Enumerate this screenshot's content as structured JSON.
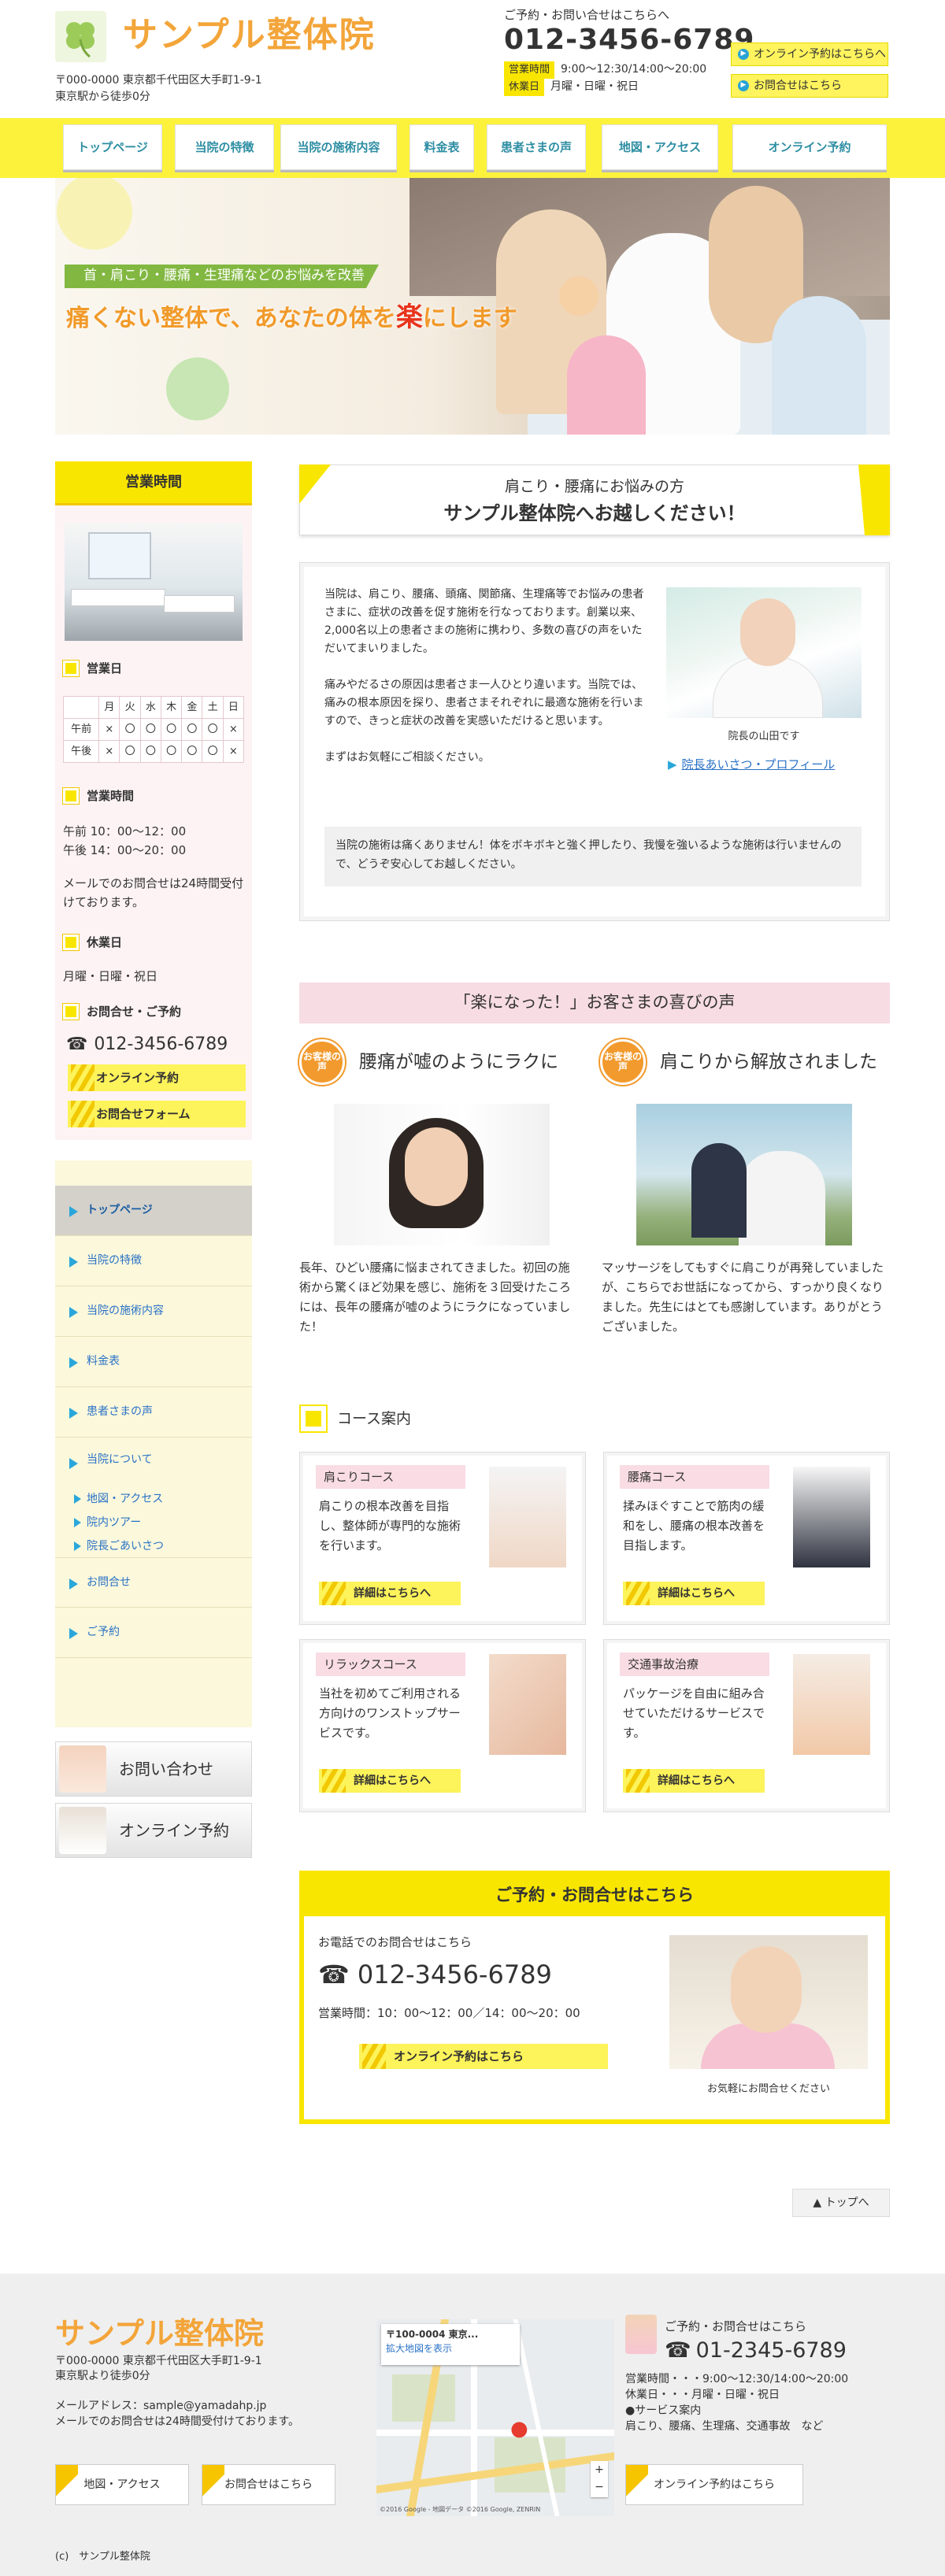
{
  "header": {
    "site_name": "サンプル整体院",
    "address_line1": "〒000-0000 東京都千代田区大手町1-9-1",
    "address_line2": "東京駅から徒歩0分",
    "tel_caption": "ご予約・お問い合せはこちらへ",
    "tel": "012-3456-6789",
    "hours_tag": "営業時間",
    "hours": "9:00〜12:30/14:00〜20:00",
    "closed_tag": "休業日",
    "closed": "月曜・日曜・祝日",
    "btn_online": "オンライン予約はこちらへ",
    "btn_contact": "お問合せはこちら"
  },
  "nav": [
    "トップページ",
    "当院の特徴",
    "当院の施術内容",
    "料金表",
    "患者さまの声",
    "地図・アクセス",
    "オンライン予約"
  ],
  "hero": {
    "tag": "首・肩こり・腰痛・生理痛などのお悩みを改善",
    "copy_pre": "痛くない整体で、あなたの体を",
    "copy_em": "楽",
    "copy_post": "にします"
  },
  "sidebar": {
    "hours_title": "営業時間",
    "sec_business_days": "営業日",
    "schedule": {
      "header": [
        "",
        "月",
        "火",
        "水",
        "木",
        "金",
        "土",
        "日"
      ],
      "rows": [
        [
          "午前",
          "×",
          "〇",
          "〇",
          "〇",
          "〇",
          "〇",
          "×"
        ],
        [
          "午後",
          "×",
          "〇",
          "〇",
          "〇",
          "〇",
          "〇",
          "×"
        ]
      ]
    },
    "sec_hours": "営業時間",
    "hours_am": "午前 10：00〜12：00",
    "hours_pm": "午後 14：00〜20：00",
    "mail_note": "メールでのお問合せは24時間受付けております。",
    "sec_closed": "休業日",
    "closed": "月曜・日曜・祝日",
    "sec_contact": "お問合せ・ご予約",
    "tel": "012-3456-6789",
    "btn_online": "オンライン予約",
    "btn_form": "お問合せフォーム",
    "menu": [
      "トップページ",
      "当院の特徴",
      "当院の施術内容",
      "料金表",
      "患者さまの声",
      "当院について"
    ],
    "submenu": [
      "地図・アクセス",
      "院内ツアー",
      "院長ごあいさつ"
    ],
    "menu2": [
      "お問合せ",
      "ご予約"
    ],
    "banner_contact": "お問い合わせ",
    "banner_online": "オンライン予約"
  },
  "main": {
    "head_line1": "肩こり・腰痛にお悩みの方",
    "head_line2": "サンプル整体院へお越しください！",
    "intro_p1": "当院は、肩こり、腰痛、頭痛、関節痛、生理痛等でお悩みの患者さまに、症状の改善を促す施術を行なっております。創業以来、2,000名以上の患者さまの施術に携わり、多数の喜びの声をいただいてまいりました。",
    "intro_p2": "痛みやだるさの原因は患者さま一人ひとり違います。当院では、痛みの根本原因を探り、患者さまそれぞれに最適な施術を行いますので、きっと症状の改善を実感いただけると思います。",
    "intro_p3": "まずはお気軽にご相談ください。",
    "doc_caption": "院長の山田です",
    "doc_link": "院長あいさつ・プロフィール",
    "note": "当院の施術は痛くありません！体をボキボキと強く押したり、我慢を強いるような施術は行いませんので、どうぞ安心してお越しください。",
    "voice_head": "「楽になった！」お客さまの喜びの声",
    "voice_badge": "お客様の声",
    "voices": [
      {
        "title": "腰痛が嘘のようにラクに",
        "text": "長年、ひどい腰痛に悩まされてきました。初回の施術から驚くほど効果を感じ、施術を３回受けたころには、長年の腰痛が嘘のようにラクになっていました！"
      },
      {
        "title": "肩こりから解放されました",
        "text": "マッサージをしてもすぐに肩こりが再発していましたが、こちらでお世話になってから、すっかり良くなりました。先生にはとても感謝しています。ありがとうございました。"
      }
    ],
    "course_head": "コース案内",
    "courses": [
      {
        "tag": "肩こりコース",
        "text": "肩こりの根本改善を目指し、整体師が専門的な施術を行います。",
        "btn": "詳細はこちらへ"
      },
      {
        "tag": "腰痛コース",
        "text": "揉みほぐすことで筋肉の緩和をし、腰痛の根本改善を目指します。",
        "btn": "詳細はこちらへ"
      },
      {
        "tag": "リラックスコース",
        "text": "当社を初めてご利用される方向けのワンストップサービスです。",
        "btn": "詳細はこちらへ"
      },
      {
        "tag": "交通事故治療",
        "text": "パッケージを自由に組み合せていただけるサービスです。",
        "btn": "詳細はこちらへ"
      }
    ],
    "res_head": "ご予約・お問合せはこちら",
    "res_caption": "お電話でのお問合せはこちら",
    "res_tel": "012-3456-6789",
    "res_hours": "営業時間：10：00〜12：00／14：00〜20：00",
    "res_btn": "オンライン予約はこちら",
    "res_photo_caption": "お気軽にお問合せください",
    "totop": "▲ トップへ"
  },
  "footer": {
    "site_name": "サンプル整体院",
    "addr1": "〒000-0000 東京都千代田区大手町1-9-1",
    "addr2": "東京駅より徒歩0分",
    "mail": "メールアドレス：sample@yamadahp.jp",
    "mail_note": "メールでのお問合せは24時間受付けております。",
    "btn_access": "地図・アクセス",
    "btn_contact": "お問合せはこちら",
    "map_addr": "〒100-0004 東京...",
    "map_link": "拡大地図を表示",
    "map_credit": "©2016 Google - 地図データ ©2016 Google, ZENRIN",
    "tel_caption": "ご予約・お問合せはこちら",
    "tel": "01-2345-6789",
    "hours": "営業時間・・・9:00〜12:30/14:00〜20:00",
    "closed": "休業日・・・月曜・日曜・祝日",
    "service_head": "●サービス案内",
    "services": "肩こり、腰痛、生理痛、交通事故　など",
    "btn_online": "オンライン予約はこちら",
    "copyright": "(c)　サンプル整体院"
  }
}
